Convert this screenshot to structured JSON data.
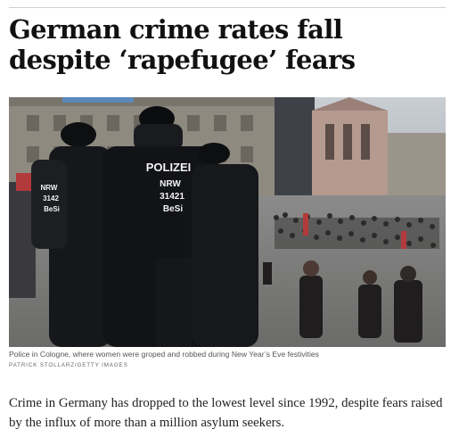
{
  "article": {
    "headline": "German crime rates fall despite ‘rapefugee’ fears",
    "photo": {
      "police_badge_back": "POLIZEI",
      "police_badge_sub": "NRW",
      "police_badge_number": "31421",
      "police_badge_code": "BeSi",
      "police_badge_side_nrw": "NRW",
      "police_badge_side_number": "3142",
      "police_badge_side_code": "BeSi"
    },
    "caption": "Police in Cologne, where women were groped and robbed during New Year’s Eve festivities",
    "credit": "Patrick Stollarz/Getty Images",
    "body": "Crime in Germany has dropped to the lowest level since 1992, despite fears raised by the influx of more than a million asylum seekers."
  },
  "colors": {
    "headline": "#111111",
    "body": "#222222",
    "caption": "#555555",
    "rule": "#cfcfcf"
  }
}
